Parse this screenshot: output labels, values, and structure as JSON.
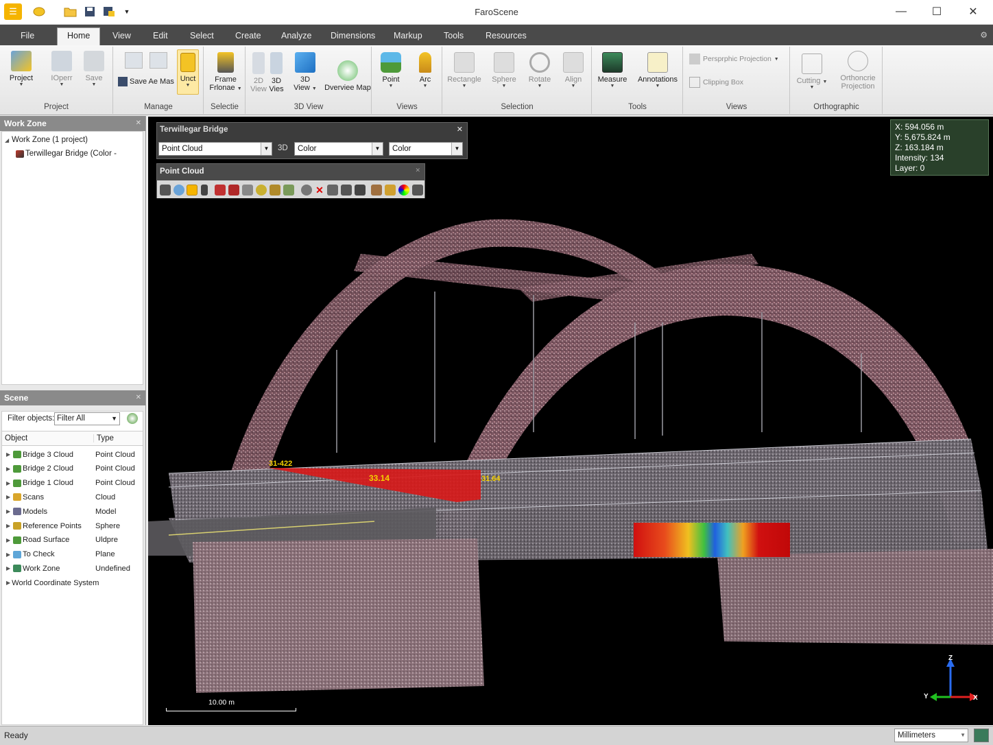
{
  "window": {
    "title": "FaroScene",
    "minimize": "—",
    "maximize": "☐",
    "close": "✕"
  },
  "menu": {
    "tabs": [
      "File",
      "Home",
      "View",
      "Edit",
      "Select",
      "Create",
      "Analyze",
      "Dimensions",
      "Markup",
      "Tools",
      "Resources"
    ],
    "active": "Home"
  },
  "ribbon": {
    "groups": [
      "Project",
      "Manage",
      "Selectie",
      "3D View",
      "Views",
      "Selection",
      "Tools",
      "Views",
      "Orthographic"
    ],
    "buttons": {
      "project": "Project",
      "open": "IOperr",
      "save": "Save",
      "save_as": "Save Ae Mas",
      "unct": "Unct",
      "frame_1": "Frame",
      "frame_2": "Frlonae",
      "view2d_1": "2D",
      "view2d_2": "View",
      "view3d_1": "3D",
      "view3d_2": "Vies",
      "view3d_big_1": "3D",
      "view3d_big_2": "View",
      "overview_map": "Dverviee Map",
      "point": "Point",
      "arc": "Arc",
      "rectangle": "Rectangle",
      "sphere": "Sphere",
      "rotate": "Rotate",
      "align": "Align",
      "measure": "Measure",
      "annotations": "Annotations",
      "perspective": "Persprphic Projection",
      "clipping": "Clipping Box",
      "cutting": "Cutting",
      "ortho_1": "Orthoncrie",
      "ortho_2": "Projection"
    }
  },
  "workzone": {
    "title": "Work Zone",
    "root": "Work Zone (1 project)",
    "child": "Terwillegar Bridge (Color -"
  },
  "scene": {
    "title": "Scene",
    "filter_label": "Filter objects:",
    "filter_value": "Filter All",
    "col_object": "Object",
    "col_type": "Type",
    "rows": [
      {
        "name": "Bridge 3 Cloud",
        "type": "Point Cloud",
        "icon": "#4e9a3a"
      },
      {
        "name": "Bridge 2 Cloud",
        "type": "Point Cloud",
        "icon": "#4e9a3a"
      },
      {
        "name": "Bridge 1 Cloud",
        "type": "Point Cloud",
        "icon": "#4e9a3a"
      },
      {
        "name": "Scans",
        "type": "Cloud",
        "icon": "#d9a62b"
      },
      {
        "name": "Models",
        "type": "Model",
        "icon": "#6b6b8f"
      },
      {
        "name": "Reference Points",
        "type": "Sphere",
        "icon": "#c9a227"
      },
      {
        "name": "Road Surface",
        "type": "Uldpre",
        "icon": "#4e9a3a"
      },
      {
        "name": "To Check",
        "type": "Plane",
        "icon": "#5ea6d8"
      },
      {
        "name": "Work Zone",
        "type": "Undefined",
        "icon": "#3c8a5a"
      },
      {
        "name": "World Coordinate System",
        "type": "",
        "icon": "#c0392b"
      }
    ]
  },
  "overlay": {
    "title": "Terwillegar Bridge",
    "combo1": "Point Cloud",
    "mode": "3D",
    "combo2": "Color",
    "combo3": "Color",
    "pc_title": "Point Cloud"
  },
  "coords": {
    "x": "X: 594.056 m",
    "y": "Y: 5,675.824 m",
    "z": "Z: 163.184 m",
    "intensity": "Intensity: 134",
    "layer": "Layer: 0"
  },
  "scalebar": "10.00 m",
  "axes": {
    "z": "Z",
    "y": "Y",
    "x": "X"
  },
  "annot": {
    "a": "31-422",
    "b": "33.14",
    "c": "31.64"
  },
  "status": {
    "text": "Ready",
    "units": "Millimeters"
  },
  "colors": {
    "accent": "#f5b400",
    "menubar": "#4a4a4a",
    "bridge_arch": "#c06a70"
  }
}
